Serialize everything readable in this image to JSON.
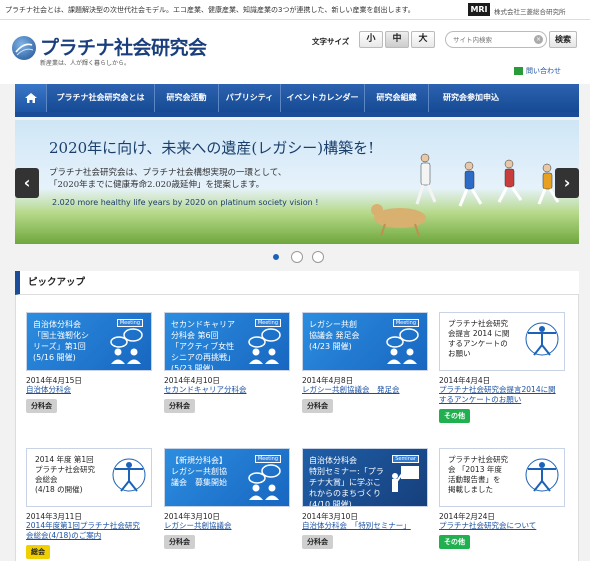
{
  "topbar": {
    "tagline": "プラチナ社会とは、課題解決型の次世代社会モデル。エコ産業、健康産業、知識産業の3つが連携した、新しい産業を創出します。",
    "company_logo": "MRI",
    "company_name": "株式会社三菱総合研究所"
  },
  "header": {
    "logo_text": "プラチナ社会研究会",
    "logo_sub": "新産業は、人が輝く暮らしから。",
    "font_size_label": "文字サイズ",
    "font_sizes": [
      "小",
      "中",
      "大"
    ],
    "font_size_selected": "中",
    "search_placeholder": "サイト内検索",
    "search_button": "検索",
    "contact": "問い合わせ"
  },
  "nav": {
    "home_icon": "home-icon",
    "items": [
      "プラチナ社会研究会とは",
      "研究会活動",
      "パブリシティ",
      "イベントカレンダー",
      "研究会組織",
      "研究会参加申込"
    ]
  },
  "hero": {
    "title": "2020年に向け、未来への遺産(レガシー)構築を!",
    "line1": "プラチナ社会研究会は、プラチナ社会構想実現の一環として、",
    "line2": "「2020年までに健康寿命2.020歳延伸」を提案します。",
    "english": "2.020 more healthy life years by 2020 on platinum society vision !",
    "prev": "‹",
    "next": "›",
    "slide_count": 3,
    "active_slide": 1
  },
  "pickup": {
    "title": "ピックアップ",
    "cards": [
      {
        "thumb": [
          "自治体分科会",
          "「国土強靭化シ",
          "リーズ」第1回",
          "(5/16 開催)"
        ],
        "tag": "Meeting",
        "style": "blue",
        "date": "2014年4月15日",
        "link": [
          "自治体分科会"
        ],
        "category": "分科会",
        "badge": "gray"
      },
      {
        "thumb": [
          "セカンドキャリア",
          "分科会 第6回",
          "「アクティブ女性",
          "シニアの再挑戦」",
          "(5/23 開催)"
        ],
        "tag": "Meeting",
        "style": "blue",
        "date": "2014年4月10日",
        "link": [
          "セカンドキャリア分科会"
        ],
        "category": "分科会",
        "badge": "gray"
      },
      {
        "thumb": [
          "レガシー共創",
          "協議会 発足会",
          "(4/23 開催)"
        ],
        "tag": "Meeting",
        "style": "blue",
        "date": "2014年4月8日",
        "link": [
          "レガシー共創協議会　発足会"
        ],
        "category": "分科会",
        "badge": "gray"
      },
      {
        "thumb": [
          "プラチナ社会研究",
          "会提言 2014 に関",
          "するアンケートの",
          "お願い"
        ],
        "tag": "",
        "style": "white",
        "date": "2014年4月4日",
        "link": [
          "プラチナ社会研究会提言2014に関",
          "するアンケートのお願い"
        ],
        "category": "その他",
        "badge": "green"
      },
      {
        "thumb": [
          "2014 年度 第1回",
          "プラチナ社会研究",
          "会総会",
          "(4/18 の開催)"
        ],
        "tag": "",
        "style": "white",
        "date": "2014年3月11日",
        "link": [
          "2014年度第1回プラチナ社会研究",
          "会総会(4/18)のご案内"
        ],
        "category": "総会",
        "badge": "yellow"
      },
      {
        "thumb": [
          "【新規分科会】",
          "レガシー共創協",
          "議会　募集開始"
        ],
        "tag": "Meeting",
        "style": "blue",
        "date": "2014年3月10日",
        "link": [
          "レガシー共創協議会"
        ],
        "category": "分科会",
        "badge": "gray"
      },
      {
        "thumb": [
          "自治体分科会",
          "特別セミナー:「プラ",
          "チナ大賞」に学ぶこ",
          "れからのまちづくり",
          "(4/10 開催)"
        ],
        "tag": "Seminar",
        "style": "dark",
        "date": "2014年3月10日",
        "link": [
          "自治体分科会　「特別セミナー」"
        ],
        "category": "分科会",
        "badge": "gray"
      },
      {
        "thumb": [
          "プラチナ社会研究",
          "会 「2013 年度",
          "活動報告書」を",
          "掲載しました"
        ],
        "tag": "",
        "style": "white",
        "date": "2014年2月24日",
        "link": [
          "プラチナ社会研究会について"
        ],
        "category": "その他",
        "badge": "green"
      }
    ]
  },
  "colors": {
    "nav": "#1a4c98",
    "link": "#1a4f9f",
    "badge_other": "#21b050",
    "badge_general": "#f0d000"
  }
}
